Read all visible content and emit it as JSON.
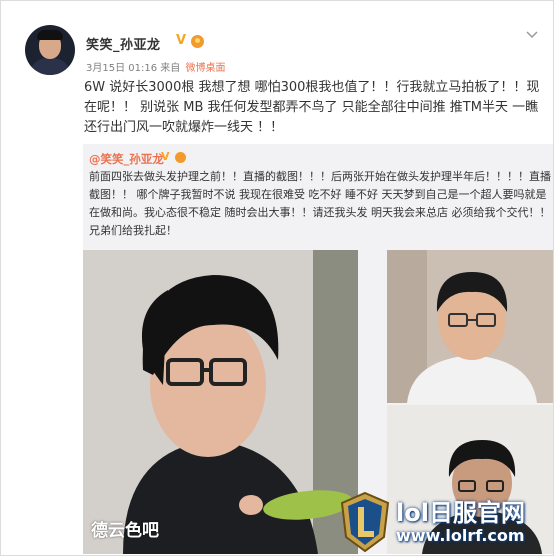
{
  "post": {
    "username": "笑笑_孙亚龙",
    "verified_icon": "verified-v-icon",
    "medal_icon": "medal-icon",
    "timestamp": "3月15日 01:16",
    "source_prefix": "来自",
    "source": "微博桌面",
    "menu_icon": "chevron-down-icon",
    "text": "6W 说好长3000根 我想了想 哪怕300根我也值了！！行我就立马拍板了！！现在呢！！ 别说张 MB 我任何发型都弄不鸟了 只能全部往中间推 推TM半天 一瞧还行出门风一吹就爆炸一线天 ！！"
  },
  "quote": {
    "author": "@笑笑_孙亚龙",
    "text": "前面四张去做头发护理之前！！直播的截图！！！后两张开始在做头发护理半年后！！！！直播截图！！ 哪个牌子我暂时不说 我现在很难受 吃不好 睡不好 天天梦到自己是一个超人要吗就是在做和尚。我心态很不稳定 随时会出大事！！请还我头发 明天我会来总店 必须给我个交代！！ 兄弟们给我扎起！",
    "photo_caption": "德云色吧"
  },
  "watermark": {
    "title": "lol日服官网",
    "url": "www.lolrf.com"
  },
  "colors": {
    "accent": "#eb7350",
    "verified": "#f6a623",
    "quote_bg": "#f2f2f5",
    "text": "#333333",
    "meta": "#808080"
  }
}
